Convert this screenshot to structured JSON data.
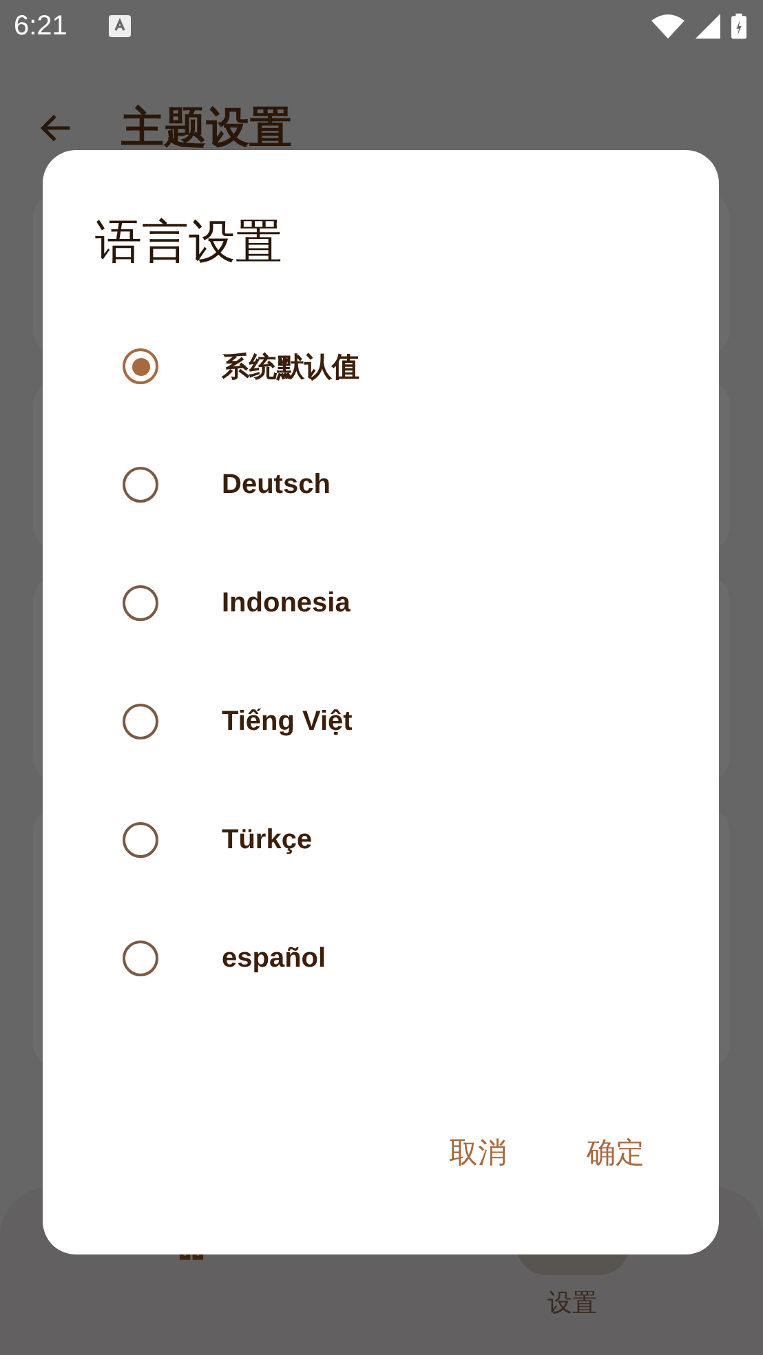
{
  "status_bar": {
    "time": "6:21"
  },
  "app_bar": {
    "title": "主题设置"
  },
  "dialog": {
    "title": "语言设置",
    "options": [
      {
        "label": "系统默认值",
        "selected": true
      },
      {
        "label": "Deutsch",
        "selected": false
      },
      {
        "label": "Indonesia",
        "selected": false
      },
      {
        "label": "Tiếng Việt",
        "selected": false
      },
      {
        "label": "Türkçe",
        "selected": false
      },
      {
        "label": "español",
        "selected": false
      }
    ],
    "buttons": [
      "取消",
      "确定"
    ]
  },
  "bottom_nav": [
    {
      "kind": "home",
      "selected": false
    },
    {
      "kind": "settings",
      "label": "设置",
      "selected": true
    }
  ]
}
